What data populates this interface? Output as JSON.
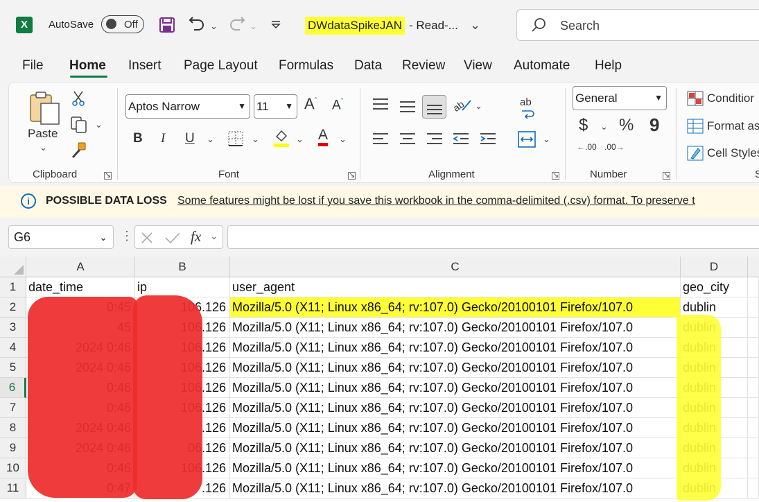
{
  "titlebar": {
    "app_icon": "excel-logo-icon",
    "app_logo_letter": "X",
    "autosave_label": "AutoSave",
    "autosave_state": "Off",
    "filename": "DWdataSpikeJAN",
    "title_suffix": "-  Read-...",
    "search_placeholder": "Search"
  },
  "menu_tabs": [
    "File",
    "Home",
    "Insert",
    "Page Layout",
    "Formulas",
    "Data",
    "Review",
    "View",
    "Automate",
    "Help"
  ],
  "active_tab": "Home",
  "ribbon": {
    "clipboard": {
      "paste_label": "Paste",
      "group_label": "Clipboard"
    },
    "font": {
      "font_name": "Aptos Narrow",
      "font_size": "11",
      "group_label": "Font",
      "bold": "B",
      "italic": "I",
      "underline": "U",
      "font_color_letter": "A",
      "grow": "A",
      "shrink": "A",
      "highlight_color": "#ffff00",
      "font_color": "#e00000"
    },
    "alignment": {
      "group_label": "Alignment",
      "wrap_label": "ab"
    },
    "number": {
      "format": "General",
      "currency": "$",
      "percent": "%",
      "comma": "9",
      "increase_decimal": ".00",
      "decrease_decimal": ".00",
      "group_label": "Number"
    },
    "styles": {
      "conditional": "Conditior",
      "format_as": "Format as",
      "cell_styles": "Cell Styles",
      "group_label": "S"
    }
  },
  "infobar": {
    "title": "POSSIBLE DATA LOSS",
    "message": "Some features might be lost if you save this workbook in the comma-delimited (.csv) format. To preserve t"
  },
  "formula_bar": {
    "name_box": "G6",
    "fx": "fx",
    "formula": ""
  },
  "sheet": {
    "columns": [
      "A",
      "B",
      "C",
      "D"
    ],
    "selected_row": 6,
    "rows": [
      {
        "num": "1",
        "a": "date_time",
        "b": "ip",
        "c": "user_agent",
        "d": "geo_city"
      },
      {
        "num": "2",
        "a": "0:45",
        "b": "106.126",
        "c": "Mozilla/5.0 (X11; Linux x86_64; rv:107.0) Gecko/20100101 Firefox/107.0",
        "d": "dublin"
      },
      {
        "num": "3",
        "a": "45",
        "b": "106.126",
        "c": "Mozilla/5.0 (X11; Linux x86_64; rv:107.0) Gecko/20100101 Firefox/107.0",
        "d": "dublin"
      },
      {
        "num": "4",
        "a": "2024 0:46",
        "b": "106.126",
        "c": "Mozilla/5.0 (X11; Linux x86_64; rv:107.0) Gecko/20100101 Firefox/107.0",
        "d": "dublin"
      },
      {
        "num": "5",
        "a": "2024 0:46",
        "b": "106.126",
        "c": "Mozilla/5.0 (X11; Linux x86_64; rv:107.0) Gecko/20100101 Firefox/107.0",
        "d": "dublin"
      },
      {
        "num": "6",
        "a": "0:46",
        "b": "106.126",
        "c": "Mozilla/5.0 (X11; Linux x86_64; rv:107.0) Gecko/20100101 Firefox/107.0",
        "d": "dublin"
      },
      {
        "num": "7",
        "a": "0:46",
        "b": "106.126",
        "c": "Mozilla/5.0 (X11; Linux x86_64; rv:107.0) Gecko/20100101 Firefox/107.0",
        "d": "dublin"
      },
      {
        "num": "8",
        "a": "2024 0:46",
        "b": ".126",
        "c": "Mozilla/5.0 (X11; Linux x86_64; rv:107.0) Gecko/20100101 Firefox/107.0",
        "d": "dublin"
      },
      {
        "num": "9",
        "a": "2024 0:46",
        "b": "06.126",
        "c": "Mozilla/5.0 (X11; Linux x86_64; rv:107.0) Gecko/20100101 Firefox/107.0",
        "d": "dublin"
      },
      {
        "num": "10",
        "a": "0:46",
        "b": "106.126",
        "c": "Mozilla/5.0 (X11; Linux x86_64; rv:107.0) Gecko/20100101 Firefox/107.0",
        "d": "dublin"
      },
      {
        "num": "11",
        "a": "0:47",
        "b": ".126",
        "c": "Mozilla/5.0 (X11; Linux x86_64; rv:107.0) Gecko/20100101 Firefox/107.0",
        "d": "dublin"
      }
    ]
  },
  "colors": {
    "excel_green": "#107c41",
    "highlight": "#ffff35",
    "redaction": "#ee2c2c",
    "info_blue": "#0f6cbd"
  }
}
